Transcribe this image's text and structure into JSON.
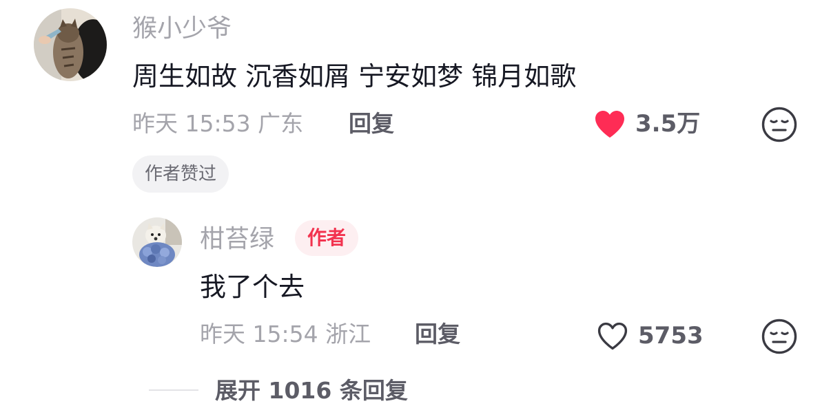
{
  "comment": {
    "username": "猴小少爷",
    "text": "周生如故 沉香如屑 宁安如梦 锦月如歌",
    "time": "昨天 15:53",
    "location": "广东",
    "reply_label": "回复",
    "likes": "3.5万",
    "liked": true,
    "author_liked_badge": "作者赞过",
    "avatar_icon": "cat-avatar"
  },
  "reply": {
    "username": "柑苔绿",
    "author_badge": "作者",
    "text": "我了个去",
    "time": "昨天 15:54",
    "location": "浙江",
    "reply_label": "回复",
    "likes": "5753",
    "liked": false,
    "avatar_icon": "dog-avatar"
  },
  "expand": {
    "label": "展开 1016 条回复"
  },
  "icons": {
    "like_filled": "heart-filled-icon",
    "like_outline": "heart-outline-icon",
    "dislike": "meh-face-icon"
  },
  "colors": {
    "like_red": "#fe2c55",
    "author_badge_text": "#f2334f",
    "author_badge_bg": "#fdeff1",
    "meta_gray": "#a4a4ab",
    "content_dark": "#161823"
  }
}
